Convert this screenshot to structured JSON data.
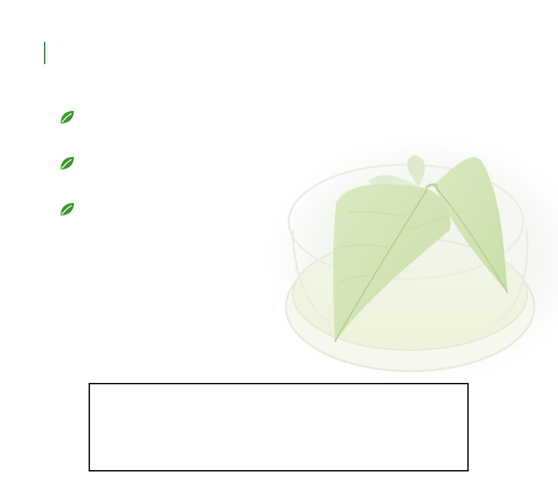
{
  "header": {
    "title": "",
    "accent_color": "#1f9a2c"
  },
  "features": {
    "icon": "leaf-icon",
    "icon_color": "#3a9a2a",
    "items": [
      {
        "label": ""
      },
      {
        "label": ""
      },
      {
        "label": ""
      }
    ]
  },
  "hero": {
    "icon": "plant-petri-dish-image"
  },
  "info_box": {
    "text": ""
  }
}
